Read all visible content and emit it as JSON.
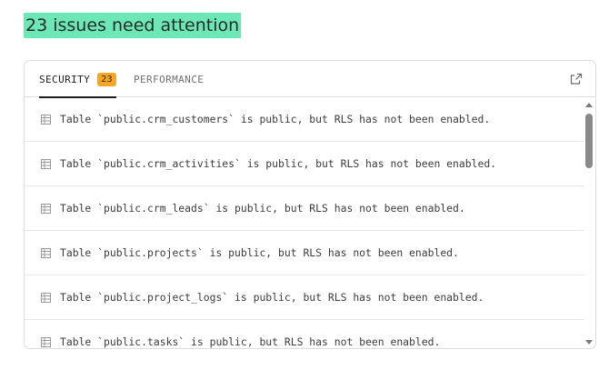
{
  "headline": "23 issues need attention",
  "tabs": [
    {
      "label": "SECURITY",
      "badge": "23",
      "active": true
    },
    {
      "label": "PERFORMANCE",
      "active": false
    }
  ],
  "colors": {
    "headline_highlight": "#6ee7b7",
    "badge": "#f5a623"
  },
  "icons": {
    "external_link": "external-link-icon",
    "row": "table-icon"
  },
  "issues": [
    "Table `public.crm_customers` is public, but RLS has not been enabled.",
    "Table `public.crm_activities` is public, but RLS has not been enabled.",
    "Table `public.crm_leads` is public, but RLS has not been enabled.",
    "Table `public.projects` is public, but RLS has not been enabled.",
    "Table `public.project_logs` is public, but RLS has not been enabled.",
    "Table `public.tasks` is public, but RLS has not been enabled."
  ]
}
